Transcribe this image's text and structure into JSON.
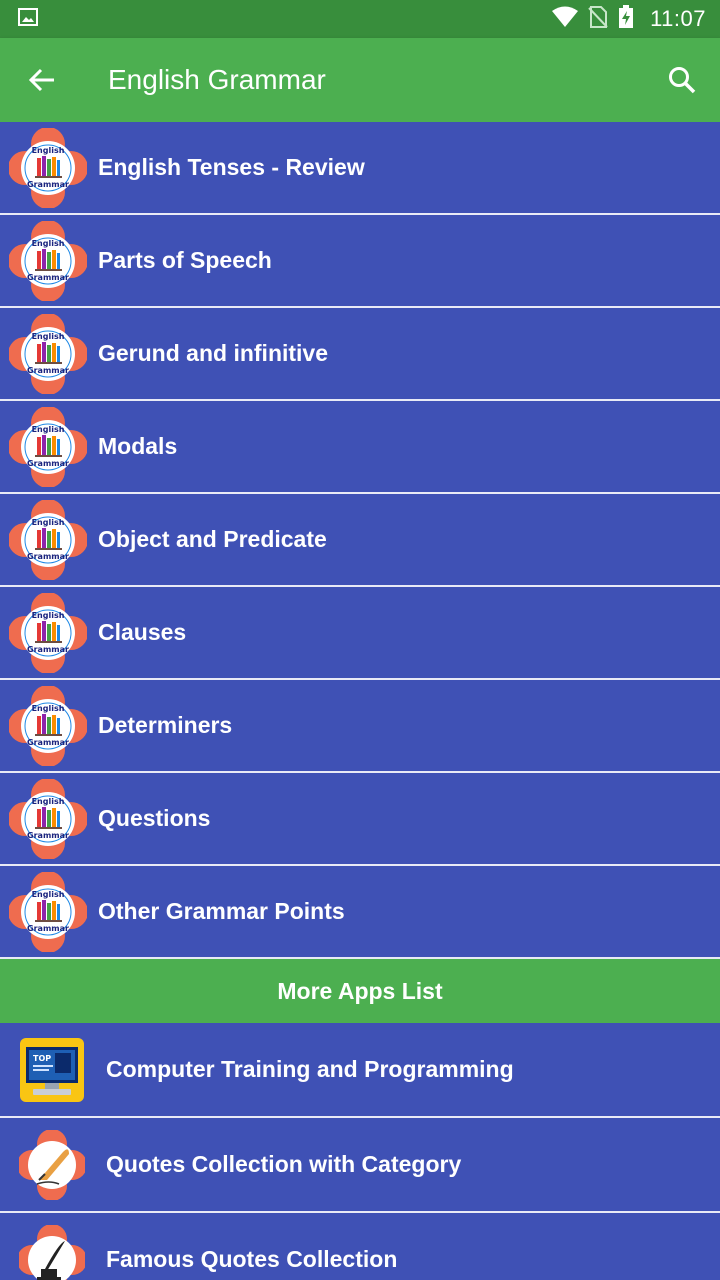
{
  "status": {
    "time": "11:07"
  },
  "app_bar": {
    "title": "English Grammar"
  },
  "colors": {
    "primary": "#3f51b5",
    "accent_green": "#4caf50",
    "status_green": "#388e3c",
    "flower": "#ef6c4f"
  },
  "icon_text": {
    "top": "English",
    "bottom": "Grammar"
  },
  "topics": [
    {
      "label": "English Tenses - Review"
    },
    {
      "label": "Parts of Speech"
    },
    {
      "label": "Gerund and infinitive"
    },
    {
      "label": "Modals"
    },
    {
      "label": "Object and Predicate"
    },
    {
      "label": "Clauses"
    },
    {
      "label": "Determiners"
    },
    {
      "label": "Questions"
    },
    {
      "label": "Other Grammar Points"
    }
  ],
  "more_apps": {
    "header": "More Apps List",
    "items": [
      {
        "label": "Computer Training and Programming",
        "icon": "computer-training-icon"
      },
      {
        "label": "Quotes Collection with Category",
        "icon": "quill-pen-icon"
      },
      {
        "label": "Famous Quotes Collection",
        "icon": "inkwell-quill-icon"
      }
    ]
  }
}
